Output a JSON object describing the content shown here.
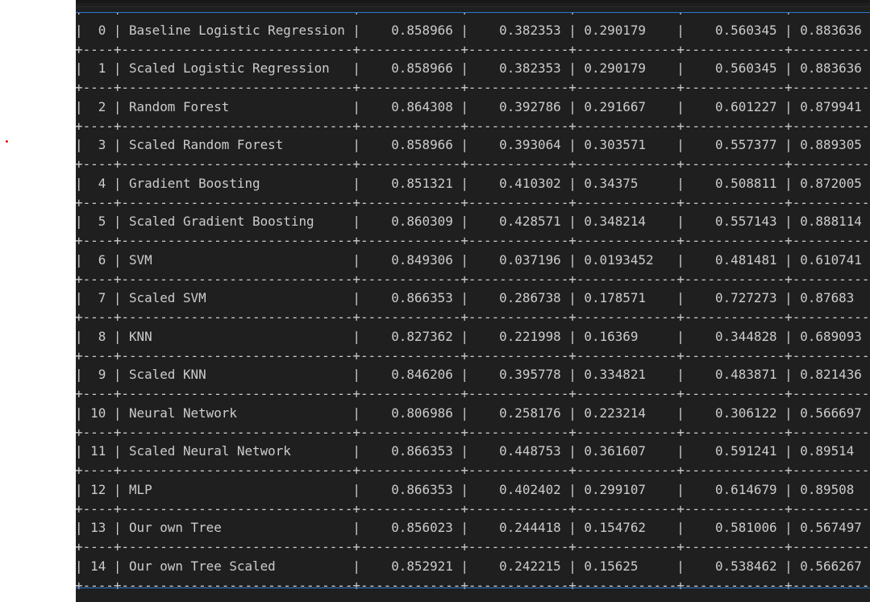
{
  "table": {
    "rows": [
      {
        "index": "0",
        "model": "Baseline Logistic Regression",
        "c1": "0.858966",
        "c2": "0.382353",
        "c3": "0.290179",
        "c4": "0.560345",
        "c5": "0.883636"
      },
      {
        "index": "1",
        "model": "Scaled Logistic Regression",
        "c1": "0.858966",
        "c2": "0.382353",
        "c3": "0.290179",
        "c4": "0.560345",
        "c5": "0.883636"
      },
      {
        "index": "2",
        "model": "Random Forest",
        "c1": "0.864308",
        "c2": "0.392786",
        "c3": "0.291667",
        "c4": "0.601227",
        "c5": "0.879941"
      },
      {
        "index": "3",
        "model": "Scaled Random Forest",
        "c1": "0.858966",
        "c2": "0.393064",
        "c3": "0.303571",
        "c4": "0.557377",
        "c5": "0.889305"
      },
      {
        "index": "4",
        "model": "Gradient Boosting",
        "c1": "0.851321",
        "c2": "0.410302",
        "c3": "0.34375",
        "c4": "0.508811",
        "c5": "0.872005"
      },
      {
        "index": "5",
        "model": "Scaled Gradient Boosting",
        "c1": "0.860309",
        "c2": "0.428571",
        "c3": "0.348214",
        "c4": "0.557143",
        "c5": "0.888114"
      },
      {
        "index": "6",
        "model": "SVM",
        "c1": "0.849306",
        "c2": "0.037196",
        "c3": "0.0193452",
        "c4": "0.481481",
        "c5": "0.610741"
      },
      {
        "index": "7",
        "model": "Scaled SVM",
        "c1": "0.866353",
        "c2": "0.286738",
        "c3": "0.178571",
        "c4": "0.727273",
        "c5": "0.87683"
      },
      {
        "index": "8",
        "model": "KNN",
        "c1": "0.827362",
        "c2": "0.221998",
        "c3": "0.16369",
        "c4": "0.344828",
        "c5": "0.689093"
      },
      {
        "index": "9",
        "model": "Scaled KNN",
        "c1": "0.846206",
        "c2": "0.395778",
        "c3": "0.334821",
        "c4": "0.483871",
        "c5": "0.821436"
      },
      {
        "index": "10",
        "model": "Neural Network",
        "c1": "0.806986",
        "c2": "0.258176",
        "c3": "0.223214",
        "c4": "0.306122",
        "c5": "0.566697"
      },
      {
        "index": "11",
        "model": "Scaled Neural Network",
        "c1": "0.866353",
        "c2": "0.448753",
        "c3": "0.361607",
        "c4": "0.591241",
        "c5": "0.89514"
      },
      {
        "index": "12",
        "model": "MLP",
        "c1": "0.866353",
        "c2": "0.402402",
        "c3": "0.299107",
        "c4": "0.614679",
        "c5": "0.89508"
      },
      {
        "index": "13",
        "model": "Our own Tree",
        "c1": "0.856023",
        "c2": "0.244418",
        "c3": "0.154762",
        "c4": "0.581006",
        "c5": "0.567497"
      },
      {
        "index": "14",
        "model": "Our own Tree Scaled",
        "c1": "0.852921",
        "c2": "0.242215",
        "c3": "0.15625",
        "c4": "0.538462",
        "c5": "0.566267"
      }
    ]
  }
}
